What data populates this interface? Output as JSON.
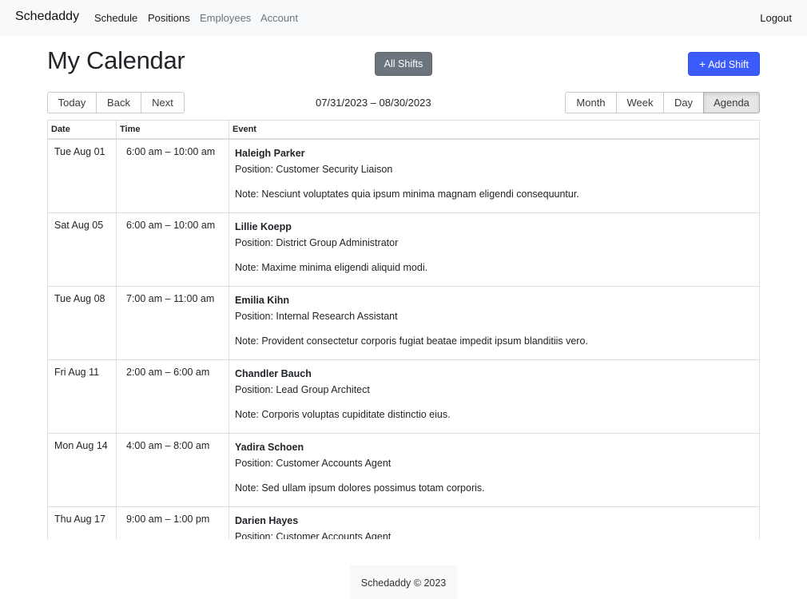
{
  "navbar": {
    "brand": "Schedaddy",
    "links": [
      {
        "label": "Schedule"
      },
      {
        "label": "Positions"
      },
      {
        "label": "Employees"
      },
      {
        "label": "Account"
      }
    ],
    "logout": "Logout"
  },
  "header": {
    "title": "My Calendar",
    "all_shifts_label": "All Shifts",
    "add_shift_label": "Add Shift"
  },
  "toolbar": {
    "nav": [
      "Today",
      "Back",
      "Next"
    ],
    "range": "07/31/2023 – 08/30/2023",
    "views": [
      "Month",
      "Week",
      "Day",
      "Agenda"
    ],
    "active_view": "Agenda"
  },
  "agenda": {
    "columns": [
      "Date",
      "Time",
      "Event"
    ],
    "rows": [
      {
        "date": "Tue Aug 01",
        "time": "6:00 am – 10:00 am",
        "name": "Haleigh Parker",
        "position": "Position: Customer Security Liaison",
        "note": "Note: Nesciunt voluptates quia ipsum minima magnam eligendi consequuntur."
      },
      {
        "date": "Sat Aug 05",
        "time": "6:00 am – 10:00 am",
        "name": "Lillie Koepp",
        "position": "Position: District Group Administrator",
        "note": "Note: Maxime minima eligendi aliquid modi."
      },
      {
        "date": "Tue Aug 08",
        "time": "7:00 am – 11:00 am",
        "name": "Emilia Kihn",
        "position": "Position: Internal Research Assistant",
        "note": "Note: Provident consectetur corporis fugiat beatae impedit ipsum blanditiis vero."
      },
      {
        "date": "Fri Aug 11",
        "time": "2:00 am – 6:00 am",
        "name": "Chandler Bauch",
        "position": "Position: Lead Group Architect",
        "note": "Note: Corporis voluptas cupiditate distinctio eius."
      },
      {
        "date": "Mon Aug 14",
        "time": "4:00 am – 8:00 am",
        "name": "Yadira Schoen",
        "position": "Position: Customer Accounts Agent",
        "note": "Note: Sed ullam ipsum dolores possimus totam corporis."
      },
      {
        "date": "Thu Aug 17",
        "time": "9:00 am – 1:00 pm",
        "name": "Darien Hayes",
        "position": "Position: Customer Accounts Agent",
        "note": ""
      }
    ]
  },
  "footer": {
    "text": "Schedaddy © 2023"
  },
  "colors": {
    "navbar_bg": "#f8f9fa",
    "secondary_button": "#6c757d",
    "primary_button": "#3b5bfd",
    "muted_link": "#6c757d"
  }
}
